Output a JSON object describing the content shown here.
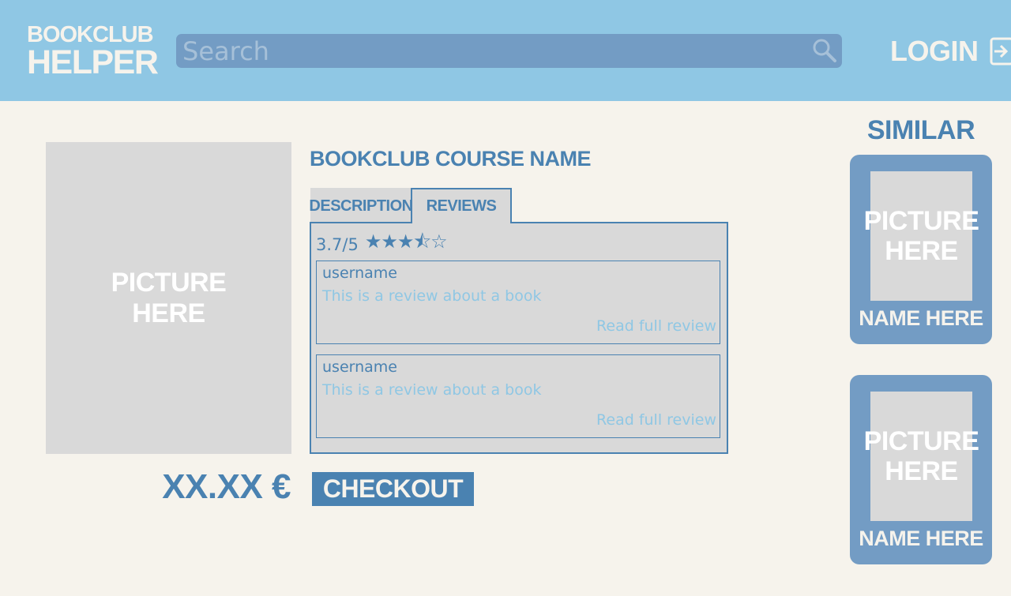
{
  "header": {
    "logo_line1": "BOOKCLUB",
    "logo_line2": "HELPER",
    "search_placeholder": "Search",
    "login_label": "LOGIN"
  },
  "product": {
    "picture_line1": "PICTURE",
    "picture_line2": "HERE",
    "title": "BOOKCLUB COURSE NAME",
    "price": "XX.XX €",
    "checkout_label": "CHECKOUT"
  },
  "tabs": {
    "description": "DESCRIPTION",
    "reviews": "REVIEWS",
    "active": "reviews"
  },
  "rating": {
    "score": "3.7/5",
    "stars": "★★★⯪☆",
    "value": 3.7,
    "max": 5
  },
  "reviews": [
    {
      "user": "username",
      "text": "This is a review about a book",
      "more": "Read full review"
    },
    {
      "user": "username",
      "text": "This is a review about a book",
      "more": "Read full review"
    }
  ],
  "similar": {
    "title": "SIMILAR",
    "items": [
      {
        "picture_line1": "PICTURE",
        "picture_line2": "HERE",
        "name": "NAME HERE"
      },
      {
        "picture_line1": "PICTURE",
        "picture_line2": "HERE",
        "name": "NAME HERE"
      }
    ]
  },
  "colors": {
    "header_bg": "#8fc7e4",
    "page_bg": "#f6f3ec",
    "accent": "#4a82b1",
    "search_bg": "#739cc4",
    "placeholder_gray": "#d9d9d9"
  }
}
